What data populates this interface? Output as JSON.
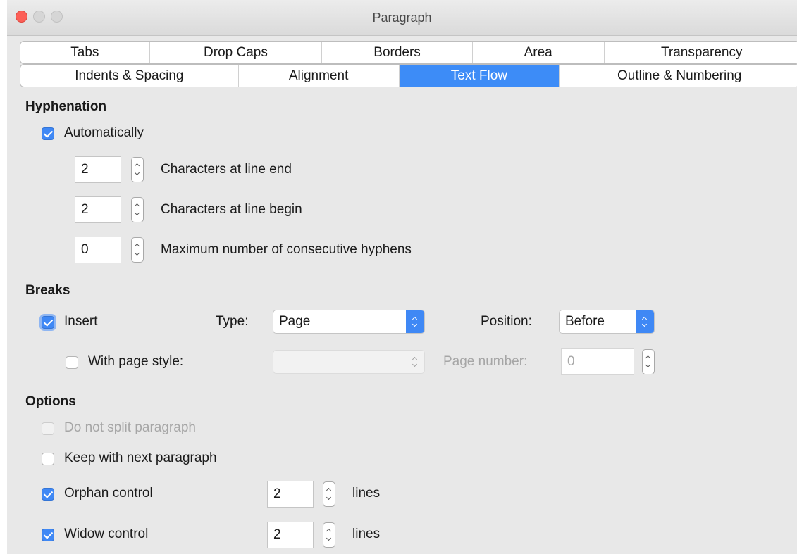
{
  "window": {
    "title": "Paragraph"
  },
  "tabs": {
    "row1": [
      "Tabs",
      "Drop Caps",
      "Borders",
      "Area",
      "Transparency"
    ],
    "row2": [
      "Indents & Spacing",
      "Alignment",
      "Text Flow",
      "Outline & Numbering"
    ],
    "active": "Text Flow"
  },
  "hyphenation": {
    "heading": "Hyphenation",
    "automatically": {
      "label": "Automatically",
      "checked": true
    },
    "chars_end": {
      "value": "2",
      "label": "Characters at line end"
    },
    "chars_begin": {
      "value": "2",
      "label": "Characters at line begin"
    },
    "max_hyphens": {
      "value": "0",
      "label": "Maximum number of consecutive hyphens"
    }
  },
  "breaks": {
    "heading": "Breaks",
    "insert": {
      "label": "Insert",
      "checked": true
    },
    "type_label": "Type:",
    "type_value": "Page",
    "position_label": "Position:",
    "position_value": "Before",
    "with_page_style": {
      "label": "With page style:",
      "checked": false
    },
    "page_style_value": "",
    "page_number_label": "Page number:",
    "page_number_value": "0"
  },
  "options": {
    "heading": "Options",
    "do_not_split": {
      "label": "Do not split paragraph",
      "checked": false,
      "disabled": true
    },
    "keep_with_next": {
      "label": "Keep with next paragraph",
      "checked": false
    },
    "orphan": {
      "label": "Orphan control",
      "checked": true,
      "value": "2",
      "unit": "lines"
    },
    "widow": {
      "label": "Widow control",
      "checked": true,
      "value": "2",
      "unit": "lines"
    }
  },
  "colors": {
    "accent": "#3f88f5",
    "active_tab": "#3d8cf7",
    "close_button": "#fc5f57"
  }
}
